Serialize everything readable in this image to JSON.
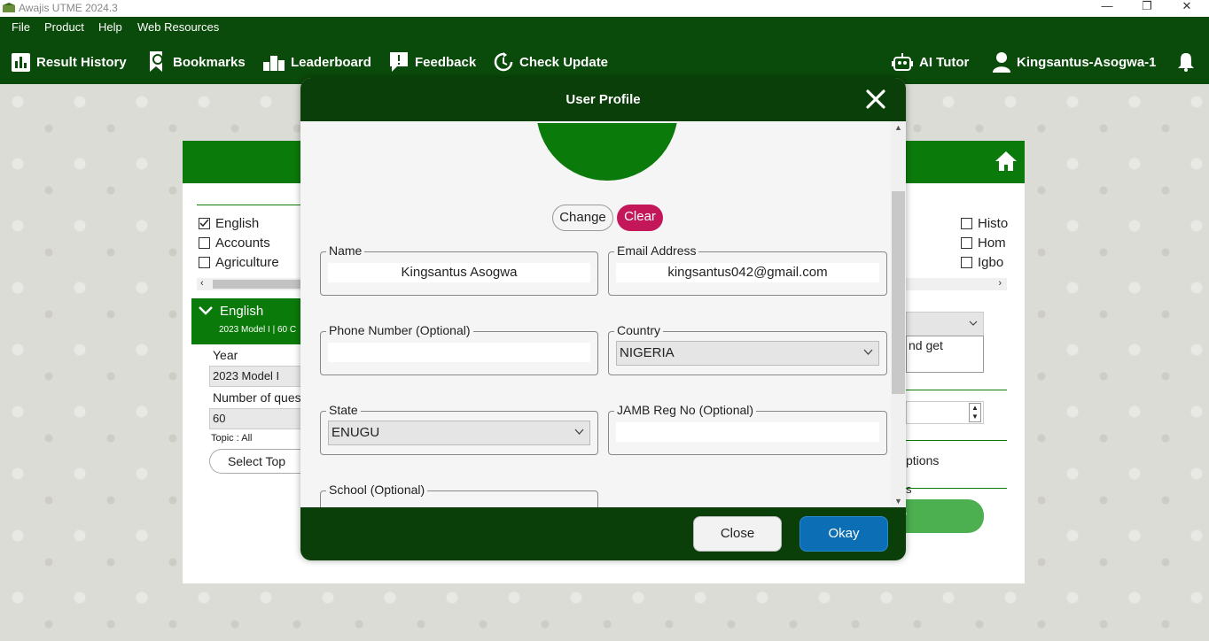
{
  "window": {
    "title": "Awajis UTME 2024.3",
    "minimize": "—",
    "restore": "❐",
    "close": "✕"
  },
  "menu": {
    "items": [
      "File",
      "Product",
      "Help",
      "Web Resources"
    ]
  },
  "toolbar": {
    "result_history": "Result History",
    "bookmarks": "Bookmarks",
    "leaderboard": "Leaderboard",
    "feedback": "Feedback",
    "check_update": "Check Update",
    "ai_tutor": "AI Tutor",
    "user": "Kingsantus-Asogwa-1"
  },
  "background": {
    "subjects_left": [
      "English",
      "Accounts",
      "Agriculture"
    ],
    "subjects_right": [
      "Histo",
      "Hom",
      "Igbo"
    ],
    "english_checked": true,
    "selected_subject": "English",
    "selected_subject_sub": "2023 Model I | 60 C",
    "year_label": "Year",
    "year_value": "2023 Model I",
    "num_questions_label": "Number of ques",
    "num_questions_value": "60",
    "topic_label": "Topic : All",
    "select_topic": "Select Top",
    "right_text_1": "nd get",
    "right_text_2": "ptions",
    "right_text_3": "s",
    "right_text_4": "v"
  },
  "dialog": {
    "title": "User Profile",
    "change": "Change",
    "clear": "Clear",
    "name_label": "Name",
    "name_value": "Kingsantus Asogwa",
    "email_label": "Email Address",
    "email_value": "kingsantus042@gmail.com",
    "phone_label": "Phone Number (Optional)",
    "phone_value": "",
    "country_label": "Country",
    "country_value": "NIGERIA",
    "state_label": "State",
    "state_value": "ENUGU",
    "jamb_label": "JAMB Reg No (Optional)",
    "jamb_value": "",
    "school_label": "School (Optional)",
    "close_button": "Close",
    "okay_button": "Okay"
  },
  "colors": {
    "dark_green": "#0a4a0a",
    "header_green": "#0a7a0a",
    "clear_pink": "#c4175a",
    "okay_blue": "#0c6fb5"
  }
}
